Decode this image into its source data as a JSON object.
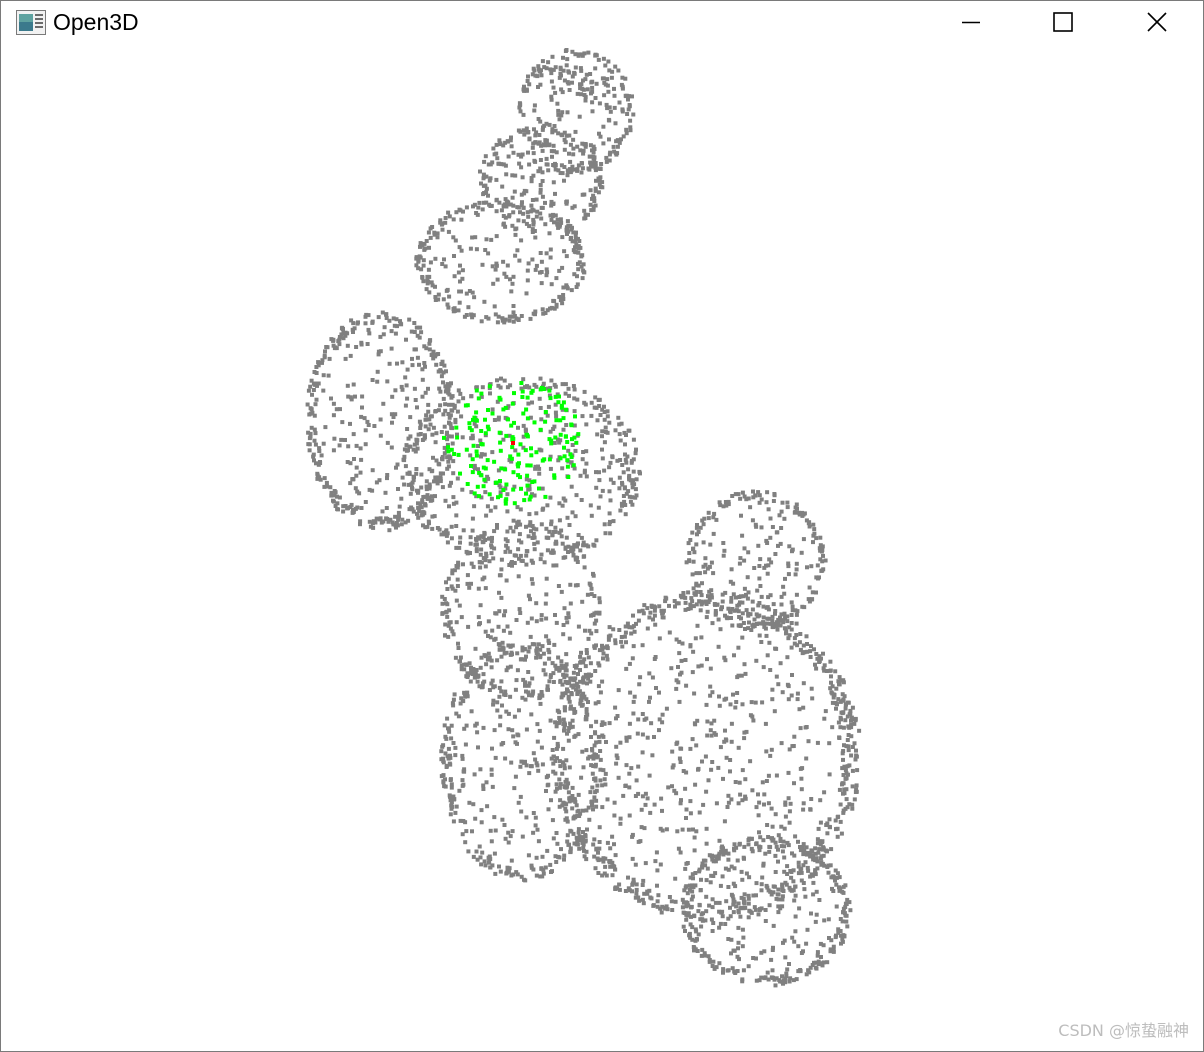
{
  "window": {
    "title": "Open3D",
    "app_icon": "open3d-window-icon",
    "controls": {
      "minimize_icon": "minimize-icon",
      "maximize_icon": "maximize-icon",
      "close_icon": "close-icon"
    }
  },
  "viewport": {
    "content": "point-cloud",
    "background_color": "#ffffff",
    "colors": {
      "points": "#808080",
      "neighbors": "#00ff00",
      "query_point": "#ff0000"
    }
  },
  "watermark": "CSDN @惊蛰融神"
}
